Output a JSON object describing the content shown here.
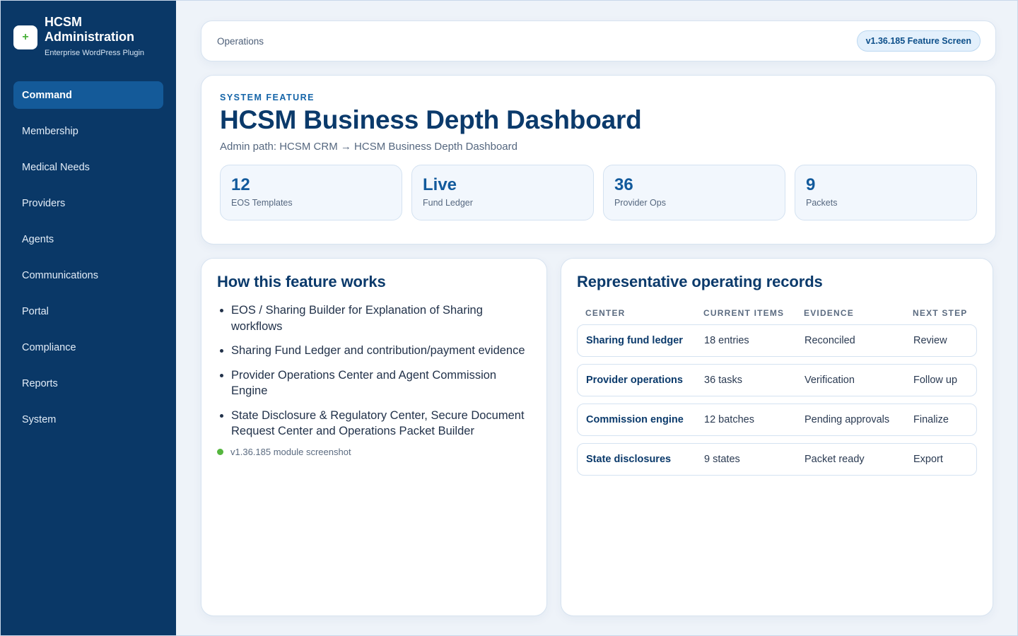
{
  "app": {
    "title": "HCSM Administration",
    "subtitle": "Enterprise WordPress Plugin",
    "logo_glyph": "+"
  },
  "sidebar": {
    "items": [
      {
        "label": "Command",
        "active": true
      },
      {
        "label": "Membership",
        "active": false
      },
      {
        "label": "Medical Needs",
        "active": false
      },
      {
        "label": "Providers",
        "active": false
      },
      {
        "label": "Agents",
        "active": false
      },
      {
        "label": "Communications",
        "active": false
      },
      {
        "label": "Portal",
        "active": false
      },
      {
        "label": "Compliance",
        "active": false
      },
      {
        "label": "Reports",
        "active": false
      },
      {
        "label": "System",
        "active": false
      }
    ]
  },
  "topbar": {
    "breadcrumb": "Operations",
    "version_badge": "v1.36.185 Feature Screen"
  },
  "hero": {
    "eyebrow": "SYSTEM FEATURE",
    "title": "HCSM Business Depth Dashboard",
    "admin_path": "Admin path: HCSM CRM → HCSM Business Depth Dashboard",
    "stats": [
      {
        "value": "12",
        "label": "EOS Templates"
      },
      {
        "value": "Live",
        "label": "Fund Ledger"
      },
      {
        "value": "36",
        "label": "Provider Ops"
      },
      {
        "value": "9",
        "label": "Packets"
      }
    ]
  },
  "how_it_works": {
    "title": "How this feature works",
    "bullets": [
      "EOS / Sharing Builder for Explanation of Sharing workflows",
      "Sharing Fund Ledger and contribution/payment evidence",
      "Provider Operations Center and Agent Commission Engine",
      "State Disclosure & Regulatory Center, Secure Document Request Center and Operations Packet Builder"
    ],
    "status_text": "v1.36.185 module screenshot"
  },
  "records": {
    "title": "Representative operating records",
    "columns": [
      "CENTER",
      "CURRENT ITEMS",
      "EVIDENCE",
      "NEXT STEP"
    ],
    "rows": [
      [
        "Sharing fund ledger",
        "18 entries",
        "Reconciled",
        "Review"
      ],
      [
        "Provider operations",
        "36 tasks",
        "Verification",
        "Follow up"
      ],
      [
        "Commission engine",
        "12 batches",
        "Pending approvals",
        "Finalize"
      ],
      [
        "State disclosures",
        "9 states",
        "Packet ready",
        "Export"
      ]
    ]
  },
  "colors": {
    "sidebar_bg": "#0a3867",
    "active_nav": "#145a99",
    "accent": "#125a9c",
    "status_green": "#55b63e"
  }
}
